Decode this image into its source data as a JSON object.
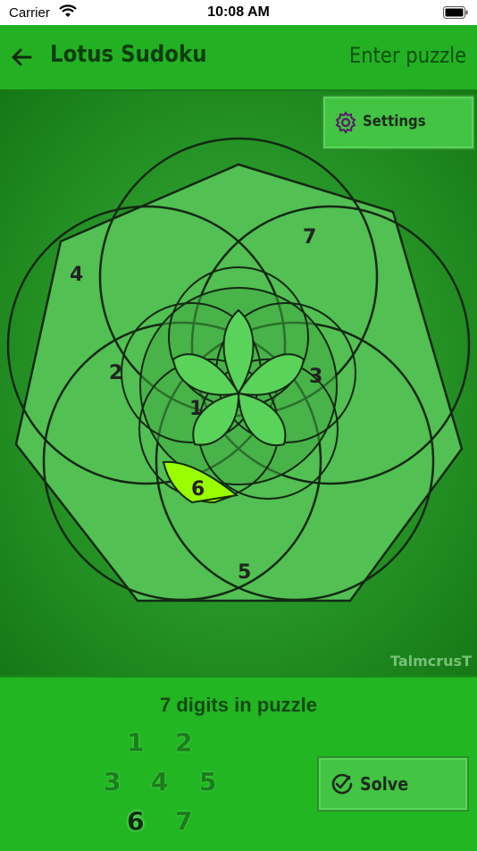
{
  "status": {
    "carrier": "Carrier",
    "time": "10:08 AM"
  },
  "nav": {
    "title": "Lotus Sudoku",
    "action": "Enter puzzle"
  },
  "settings": {
    "label": "Settings"
  },
  "board": {
    "cells": [
      {
        "digit": "4"
      },
      {
        "digit": "7"
      },
      {
        "digit": "2"
      },
      {
        "digit": "3"
      },
      {
        "digit": "1"
      },
      {
        "digit": "6",
        "highlighted": true
      },
      {
        "digit": "5"
      }
    ],
    "highlight_color": "#99ff00"
  },
  "watermark": "TalmcrusT",
  "footer": {
    "digit_count_text": "7 digits in puzzle",
    "keypad": [
      "1",
      "2",
      "3",
      "4",
      "5",
      "6",
      "7"
    ],
    "selected_digit": "6",
    "solve_label": "Solve"
  },
  "colors": {
    "nav": "#23b123",
    "petal": "#58c858",
    "lines": "#142814"
  }
}
